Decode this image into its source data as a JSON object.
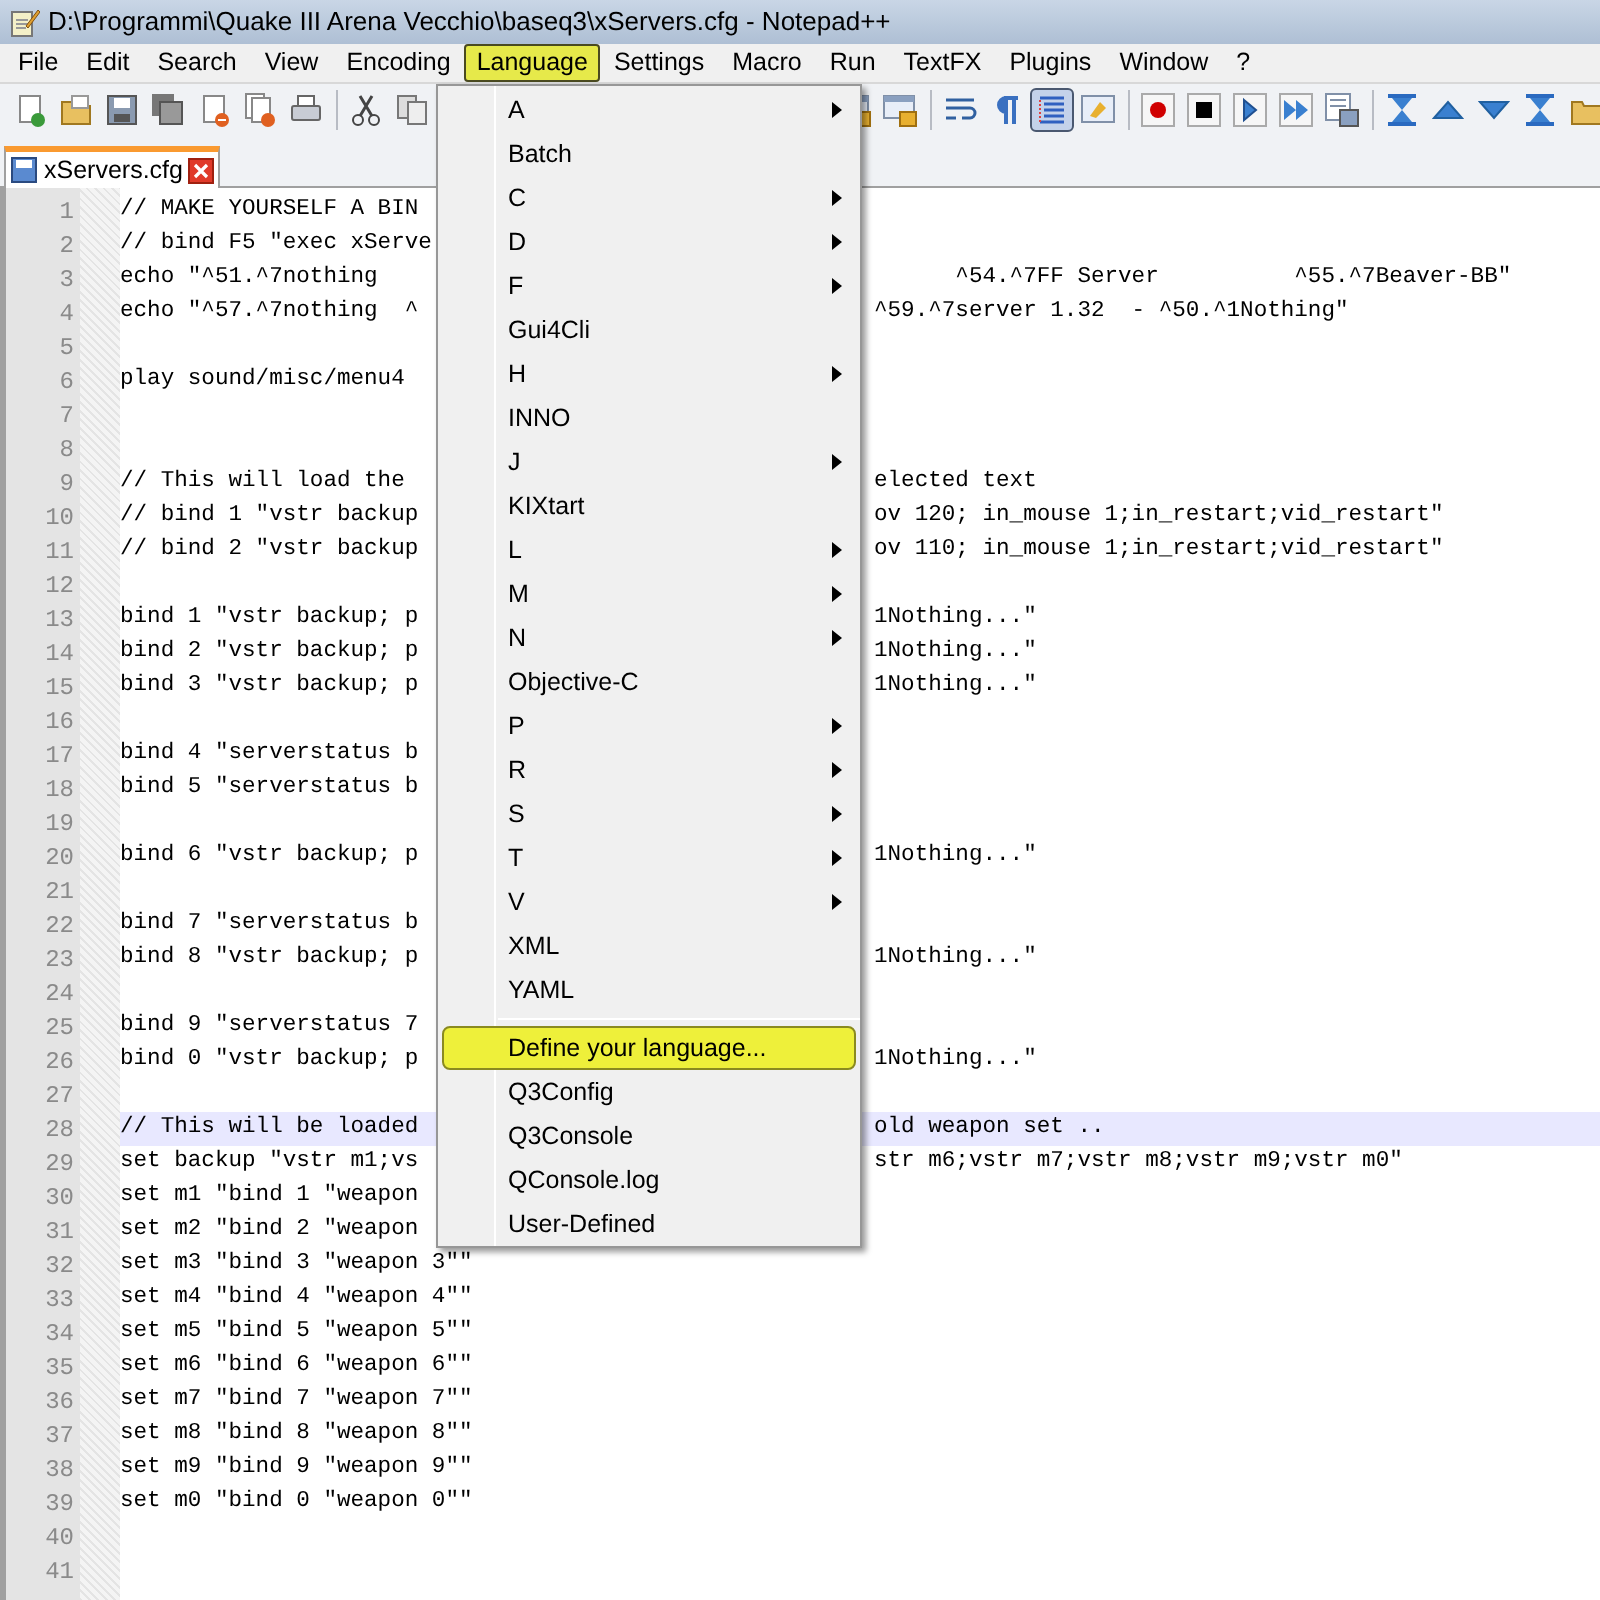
{
  "window": {
    "title": "D:\\Programmi\\Quake III Arena Vecchio\\baseq3\\xServers.cfg - Notepad++"
  },
  "menu_bar": [
    {
      "label": "File",
      "selected": false
    },
    {
      "label": "Edit",
      "selected": false
    },
    {
      "label": "Search",
      "selected": false
    },
    {
      "label": "View",
      "selected": false
    },
    {
      "label": "Encoding",
      "selected": false
    },
    {
      "label": "Language",
      "selected": true
    },
    {
      "label": "Settings",
      "selected": false
    },
    {
      "label": "Macro",
      "selected": false
    },
    {
      "label": "Run",
      "selected": false
    },
    {
      "label": "TextFX",
      "selected": false
    },
    {
      "label": "Plugins",
      "selected": false
    },
    {
      "label": "Window",
      "selected": false
    },
    {
      "label": "?",
      "selected": false
    }
  ],
  "toolbar_left": [
    {
      "kind": "new",
      "selected": false
    },
    {
      "kind": "open",
      "selected": false
    },
    {
      "kind": "save",
      "selected": false
    },
    {
      "kind": "saveall",
      "selected": false
    },
    {
      "kind": "close",
      "selected": false
    },
    {
      "kind": "closeall",
      "selected": false
    },
    {
      "kind": "print",
      "selected": false
    },
    {
      "kind": "sep"
    },
    {
      "kind": "cut",
      "selected": false
    },
    {
      "kind": "copy",
      "selected": false
    }
  ],
  "toolbar_right": [
    {
      "kind": "lock",
      "selected": false
    },
    {
      "kind": "lock",
      "selected": false
    },
    {
      "kind": "sep"
    },
    {
      "kind": "wrap",
      "selected": false
    },
    {
      "kind": "pilcrow",
      "selected": false
    },
    {
      "kind": "indent",
      "selected": true
    },
    {
      "kind": "docmap",
      "selected": false
    },
    {
      "kind": "sep"
    },
    {
      "kind": "record",
      "selected": false
    },
    {
      "kind": "stop",
      "selected": false
    },
    {
      "kind": "play",
      "selected": false
    },
    {
      "kind": "playmulti",
      "selected": false
    },
    {
      "kind": "savemacro",
      "selected": false
    },
    {
      "kind": "sep"
    },
    {
      "kind": "syncup",
      "selected": false
    },
    {
      "kind": "up",
      "selected": false
    },
    {
      "kind": "down",
      "selected": false
    },
    {
      "kind": "syncdown",
      "selected": false
    },
    {
      "kind": "folder",
      "selected": false
    }
  ],
  "tabs": [
    {
      "label": "xServers.cfg",
      "selected": true
    }
  ],
  "editor": {
    "lines": [
      {
        "number": "1",
        "left": "// MAKE YOURSELF A BIN"
      },
      {
        "number": "2",
        "left": "// bind F5 \"exec xServe"
      },
      {
        "number": "3",
        "left": "echo \"^51.^7nothing",
        "right": "      ^54.^7FF Server          ^55.^7Beaver-BB\""
      },
      {
        "number": "4",
        "left": "echo \"^57.^7nothing  ^",
        "right": "^59.^7server 1.32  - ^50.^1Nothing\""
      },
      {
        "number": "5"
      },
      {
        "number": "6",
        "left": "play sound/misc/menu4"
      },
      {
        "number": "7"
      },
      {
        "number": "8"
      },
      {
        "number": "9",
        "left": "// This will load the",
        "right": "elected text"
      },
      {
        "number": "10",
        "left": "// bind 1 \"vstr backup",
        "right": "ov 120; in_mouse 1;in_restart;vid_restart\""
      },
      {
        "number": "11",
        "left": "// bind 2 \"vstr backup",
        "right": "ov 110; in_mouse 1;in_restart;vid_restart\""
      },
      {
        "number": "12"
      },
      {
        "number": "13",
        "left": "bind 1 \"vstr backup; p",
        "right": "1Nothing...\""
      },
      {
        "number": "14",
        "left": "bind 2 \"vstr backup; p",
        "right": "1Nothing...\""
      },
      {
        "number": "15",
        "left": "bind 3 \"vstr backup; p",
        "right": "1Nothing...\""
      },
      {
        "number": "16"
      },
      {
        "number": "17",
        "left": "bind 4 \"serverstatus b"
      },
      {
        "number": "18",
        "left": "bind 5 \"serverstatus b"
      },
      {
        "number": "19"
      },
      {
        "number": "20",
        "left": "bind 6 \"vstr backup; p",
        "right": "1Nothing...\""
      },
      {
        "number": "21"
      },
      {
        "number": "22",
        "left": "bind 7 \"serverstatus b"
      },
      {
        "number": "23",
        "left": "bind 8 \"vstr backup; p",
        "right": "1Nothing...\""
      },
      {
        "number": "24"
      },
      {
        "number": "25",
        "left": "bind 9 \"serverstatus 7"
      },
      {
        "number": "26",
        "left": "bind 0 \"vstr backup; p",
        "right": "1Nothing...\""
      },
      {
        "number": "27"
      },
      {
        "number": "28",
        "left": "// This will be loaded",
        "right": "old weapon set ..",
        "current": true
      },
      {
        "number": "29",
        "left": "set backup \"vstr m1;vs",
        "right": "str m6;vstr m7;vstr m8;vstr m9;vstr m0\""
      },
      {
        "number": "30",
        "left": "set m1 \"bind 1 \"weapon"
      },
      {
        "number": "31",
        "left": "set m2 \"bind 2 \"weapon"
      },
      {
        "number": "32",
        "left": "set m3 \"bind 3 \"weapon 3\"\""
      },
      {
        "number": "33",
        "left": "set m4 \"bind 4 \"weapon 4\"\""
      },
      {
        "number": "34",
        "left": "set m5 \"bind 5 \"weapon 5\"\""
      },
      {
        "number": "35",
        "left": "set m6 \"bind 6 \"weapon 6\"\""
      },
      {
        "number": "36",
        "left": "set m7 \"bind 7 \"weapon 7\"\""
      },
      {
        "number": "37",
        "left": "set m8 \"bind 8 \"weapon 8\"\""
      },
      {
        "number": "38",
        "left": "set m9 \"bind 9 \"weapon 9\"\""
      },
      {
        "number": "39",
        "left": "set m0 \"bind 0 \"weapon 0\"\""
      },
      {
        "number": "40"
      },
      {
        "number": "41"
      }
    ]
  },
  "language_menu": {
    "items": [
      {
        "kind": "item",
        "label": "A",
        "submenu": true,
        "selected": false
      },
      {
        "kind": "item",
        "label": "Batch",
        "submenu": false,
        "selected": false
      },
      {
        "kind": "item",
        "label": "C",
        "submenu": true,
        "selected": false
      },
      {
        "kind": "item",
        "label": "D",
        "submenu": true,
        "selected": false
      },
      {
        "kind": "item",
        "label": "F",
        "submenu": true,
        "selected": false
      },
      {
        "kind": "item",
        "label": "Gui4Cli",
        "submenu": false,
        "selected": false
      },
      {
        "kind": "item",
        "label": "H",
        "submenu": true,
        "selected": false
      },
      {
        "kind": "item",
        "label": "INNO",
        "submenu": false,
        "selected": false
      },
      {
        "kind": "item",
        "label": "J",
        "submenu": true,
        "selected": false
      },
      {
        "kind": "item",
        "label": "KIXtart",
        "submenu": false,
        "selected": false
      },
      {
        "kind": "item",
        "label": "L",
        "submenu": true,
        "selected": false
      },
      {
        "kind": "item",
        "label": "M",
        "submenu": true,
        "selected": false
      },
      {
        "kind": "item",
        "label": "N",
        "submenu": true,
        "selected": false
      },
      {
        "kind": "item",
        "label": "Objective-C",
        "submenu": false,
        "selected": false
      },
      {
        "kind": "item",
        "label": "P",
        "submenu": true,
        "selected": false
      },
      {
        "kind": "item",
        "label": "R",
        "submenu": true,
        "selected": false
      },
      {
        "kind": "item",
        "label": "S",
        "submenu": true,
        "selected": false
      },
      {
        "kind": "item",
        "label": "T",
        "submenu": true,
        "selected": false
      },
      {
        "kind": "item",
        "label": "V",
        "submenu": true,
        "selected": false
      },
      {
        "kind": "item",
        "label": "XML",
        "submenu": false,
        "selected": false
      },
      {
        "kind": "item",
        "label": "YAML",
        "submenu": false,
        "selected": false
      },
      {
        "kind": "separator"
      },
      {
        "kind": "item",
        "label": "Define your language...",
        "submenu": false,
        "selected": true
      },
      {
        "kind": "item",
        "label": "Q3Config",
        "submenu": false,
        "selected": false
      },
      {
        "kind": "item",
        "label": "Q3Console",
        "submenu": false,
        "selected": false
      },
      {
        "kind": "item",
        "label": "QConsole.log",
        "submenu": false,
        "selected": false
      },
      {
        "kind": "item",
        "label": "User-Defined",
        "submenu": false,
        "selected": false
      }
    ]
  }
}
